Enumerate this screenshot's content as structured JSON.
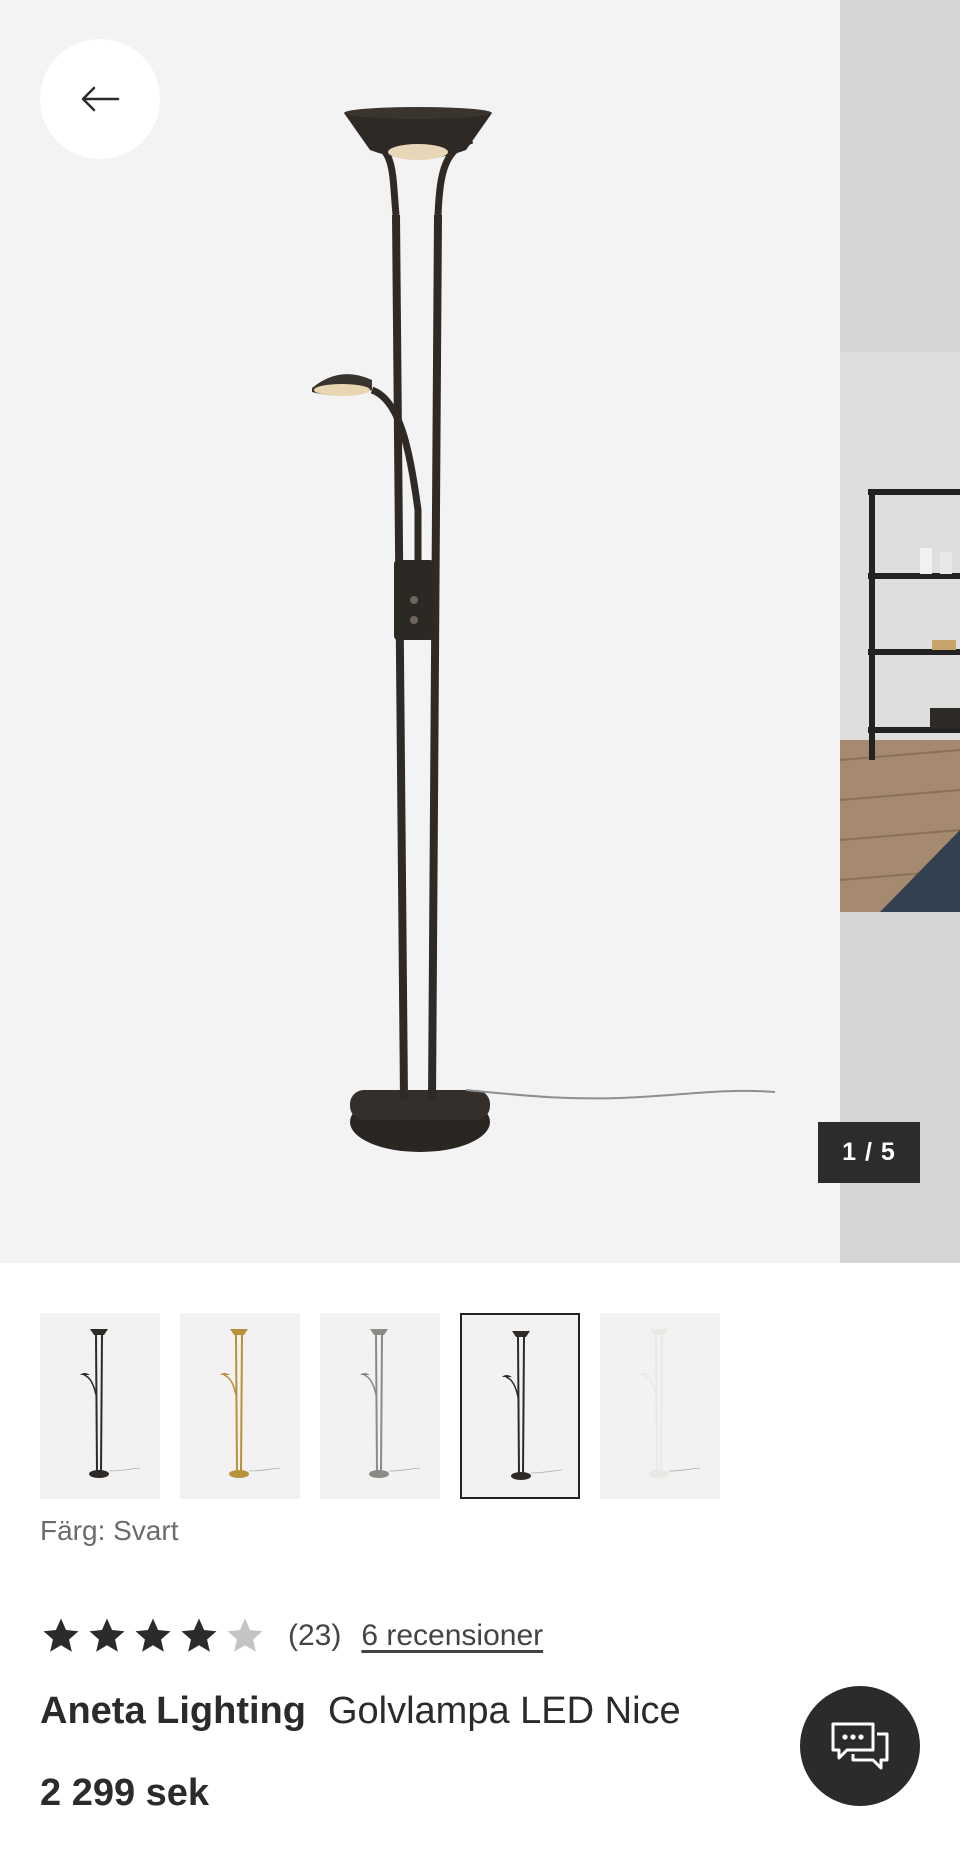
{
  "gallery": {
    "counter": "1 / 5",
    "current_image": 1,
    "total_images": 5,
    "back_icon": "arrow-left-icon"
  },
  "thumbnails": [
    {
      "variant": "Svart",
      "color": "#2e2a26",
      "selected": false
    },
    {
      "variant": "Mässing",
      "color": "#b8923a",
      "selected": false
    },
    {
      "variant": "Stål",
      "color": "#8c8a86",
      "selected": false
    },
    {
      "variant": "Svart",
      "color": "#2e2a26",
      "selected": true
    },
    {
      "variant": "Vit",
      "color": "#e9e8e2",
      "selected": false
    }
  ],
  "product": {
    "color_label": "Färg: Svart",
    "rating": 4,
    "rating_max": 5,
    "rating_count": "(23)",
    "reviews_link": "6 recensioner",
    "brand": "Aneta Lighting",
    "name": "Golvlampa LED Nice",
    "price": "2 299 sek"
  },
  "chat": {
    "icon": "chat-bubbles-icon"
  },
  "colors": {
    "dark": "#2b2b2b",
    "star_filled": "#2b2b2b",
    "star_empty": "#c4c4c4",
    "background": "#f4f3f4"
  }
}
